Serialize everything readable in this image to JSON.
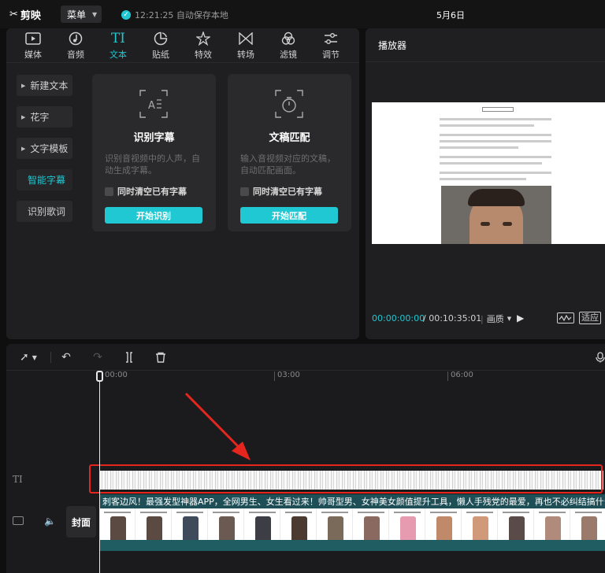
{
  "app": {
    "logo_text": "剪映",
    "menu_label": "菜单",
    "save_status": "12:21:25 自动保存本地",
    "project_title": "5月6日"
  },
  "toolbar": {
    "tabs": [
      {
        "label": "媒体",
        "icon": "media-icon"
      },
      {
        "label": "音频",
        "icon": "audio-icon"
      },
      {
        "label": "文本",
        "icon": "text-icon",
        "active": true
      },
      {
        "label": "贴纸",
        "icon": "sticker-icon"
      },
      {
        "label": "特效",
        "icon": "effects-icon"
      },
      {
        "label": "转场",
        "icon": "transition-icon"
      },
      {
        "label": "滤镜",
        "icon": "filter-icon"
      },
      {
        "label": "调节",
        "icon": "adjust-icon"
      }
    ],
    "text_icon_glyph": "TI"
  },
  "sidebar": {
    "items": [
      {
        "label": "新建文本"
      },
      {
        "label": "花字"
      },
      {
        "label": "文字模板"
      },
      {
        "label": "智能字幕",
        "active": true
      },
      {
        "label": "识别歌词"
      }
    ]
  },
  "cards": [
    {
      "title": "识别字幕",
      "desc": "识别音视频中的人声，自动生成字幕。",
      "checkbox_label": "同时清空已有字幕",
      "button_label": "开始识别"
    },
    {
      "title": "文稿匹配",
      "desc": "输入音视频对应的文稿，自动匹配画面。",
      "checkbox_label": "同时清空已有字幕",
      "button_label": "开始匹配"
    }
  ],
  "player": {
    "title": "播放器",
    "time_current": "00:00:00:00",
    "time_total": "/ 00:10:35:01",
    "quality_label": "画质",
    "fit_label": "适应"
  },
  "timeline": {
    "ticks": [
      "00:00",
      "03:00",
      "06:00"
    ],
    "text_track_icon": "TI",
    "cover_label": "封面",
    "caption_text": "刺客边风！最强发型神器APP，全网男生、女生看过来！帅哥型男、女神美女颜值提升工具，懒人手残党的最爱，再也不必纠结搞什么发型，选择"
  },
  "colors": {
    "accent": "#1fc8d2",
    "highlight": "#e5261e",
    "panel_bg": "#1f1f21"
  }
}
